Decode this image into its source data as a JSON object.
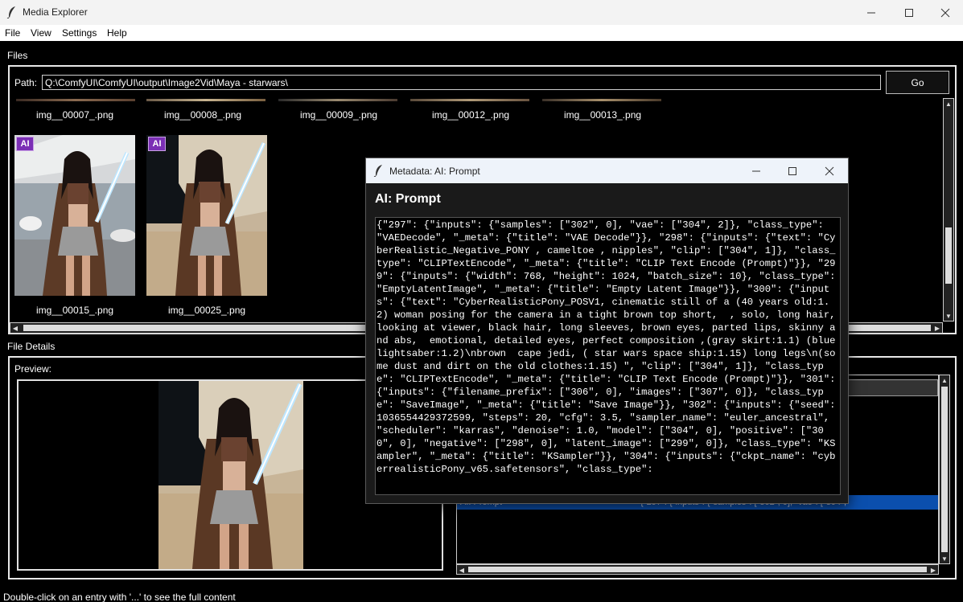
{
  "window": {
    "title": "Media Explorer"
  },
  "menu": {
    "file": "File",
    "view": "View",
    "settings": "Settings",
    "help": "Help"
  },
  "files": {
    "section_label": "Files",
    "path_label": "Path:",
    "path_value": "Q:\\ComfyUI\\ComfyUI\\output\\Image2Vid\\Maya - starwars\\",
    "go_label": "Go",
    "row1_captions": [
      "img__00007_.png",
      "img__00008_.png",
      "img__00009_.png",
      "img__00012_.png",
      "img__00013_.png"
    ],
    "row2": [
      {
        "badge": "AI",
        "caption": "img__00015_.png"
      },
      {
        "badge": "AI",
        "caption": "img__00025_.png"
      }
    ]
  },
  "details": {
    "section_label": "File Details",
    "preview_label": "Preview:",
    "selected_row_key": "AI: Prompt",
    "selected_row_value": "{\"297\": {\"inputs\": {\"samples\": [\"302\", 0], \"vae\": [\"304\","
  },
  "status": "Double-click on an entry with '...' to see the full content",
  "metadata_window": {
    "title": "Metadata: AI: Prompt",
    "heading": "AI: Prompt",
    "text": "{\"297\": {\"inputs\": {\"samples\": [\"302\", 0], \"vae\": [\"304\", 2]}, \"class_type\": \"VAEDecode\", \"_meta\": {\"title\": \"VAE Decode\"}}, \"298\": {\"inputs\": {\"text\": \"CyberRealistic_Negative_PONY , cameltoe , nipples\", \"clip\": [\"304\", 1]}, \"class_type\": \"CLIPTextEncode\", \"_meta\": {\"title\": \"CLIP Text Encode (Prompt)\"}}, \"299\": {\"inputs\": {\"width\": 768, \"height\": 1024, \"batch_size\": 10}, \"class_type\": \"EmptyLatentImage\", \"_meta\": {\"title\": \"Empty Latent Image\"}}, \"300\": {\"inputs\": {\"text\": \"CyberRealisticPony_POSV1, cinematic still of a (40 years old:1.2) woman posing for the camera in a tight brown top short,  , solo, long hair, looking at viewer, black hair, long sleeves, brown eyes, parted lips, skinny and abs,  emotional, detailed eyes, perfect composition ,(gray skirt:1.1) (blue lightsaber:1.2)\\nbrown  cape jedi, ( star wars space ship:1.15) long legs\\n(some dust and dirt on the old clothes:1.15) \", \"clip\": [\"304\", 1]}, \"class_type\": \"CLIPTextEncode\", \"_meta\": {\"title\": \"CLIP Text Encode (Prompt)\"}}, \"301\": {\"inputs\": {\"filename_prefix\": [\"306\", 0], \"images\": [\"307\", 0]}, \"class_type\": \"SaveImage\", \"_meta\": {\"title\": \"Save Image\"}}, \"302\": {\"inputs\": {\"seed\": 1036554429372599, \"steps\": 20, \"cfg\": 3.5, \"sampler_name\": \"euler_ancestral\", \"scheduler\": \"karras\", \"denoise\": 1.0, \"model\": [\"304\", 0], \"positive\": [\"300\", 0], \"negative\": [\"298\", 0], \"latent_image\": [\"299\", 0]}, \"class_type\": \"KSampler\", \"_meta\": {\"title\": \"KSampler\"}}, \"304\": {\"inputs\": {\"ckpt_name\": \"cyberrealisticPony_v65.safetensors\", \"class_type\":"
  },
  "colors": {
    "accent_selection": "#0b4fad",
    "ai_badge": "#7b2fb5"
  }
}
